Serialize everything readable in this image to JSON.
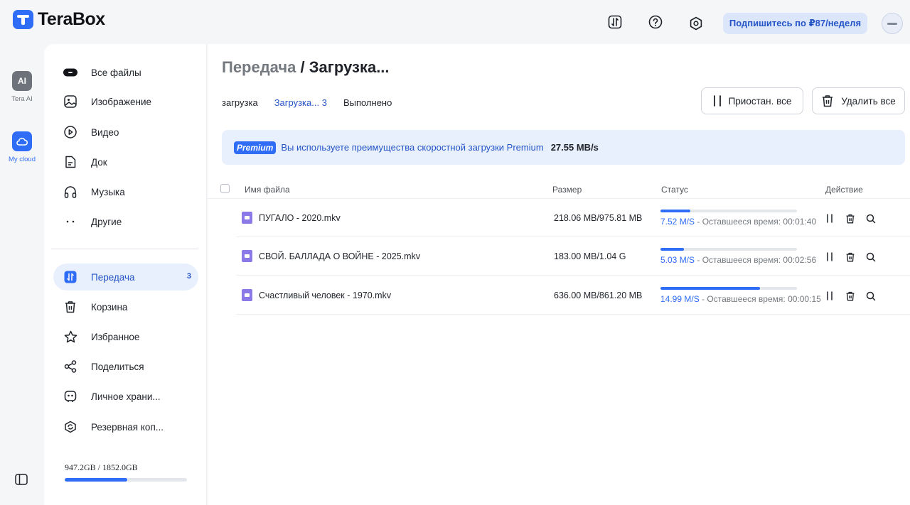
{
  "app": {
    "name": "TeraBox"
  },
  "header": {
    "subscribe_label": "Подпишитесь по ₽87/неделя",
    "icons": [
      "transfer-icon",
      "help-icon",
      "settings-icon"
    ]
  },
  "rail": {
    "items": [
      {
        "label": "Tera AI",
        "icon_text": "AI"
      },
      {
        "label": "My cloud"
      }
    ]
  },
  "sidebar": {
    "items": [
      {
        "label": "Все файлы"
      },
      {
        "label": "Изображение"
      },
      {
        "label": "Видео"
      },
      {
        "label": "Док"
      },
      {
        "label": "Музыка"
      },
      {
        "label": "Другие"
      },
      {
        "label": "Передача",
        "badge": "3"
      },
      {
        "label": "Корзина"
      },
      {
        "label": "Избранное"
      },
      {
        "label": "Поделиться"
      },
      {
        "label": "Личное храни..."
      },
      {
        "label": "Резервная коп..."
      }
    ],
    "storage": {
      "used": "947.2GB",
      "total": "1852.0GB",
      "fraction": 0.511
    }
  },
  "main": {
    "title_crumb": "Передача",
    "title_sep": " / ",
    "title_current": "Загрузка...",
    "tabs": [
      {
        "label": "загрузка"
      },
      {
        "label": "Загрузка... 3",
        "active": true
      },
      {
        "label": "Выполнено"
      }
    ],
    "pause_all_label": "Приостан. все",
    "delete_all_label": "Удалить все",
    "banner": {
      "badge": "Premium",
      "text": "Вы используете преимущества скоростной загрузки Premium",
      "speed": "27.55 MB/s"
    },
    "columns": {
      "name": "Имя файла",
      "size": "Размер",
      "status": "Статус",
      "action": "Действие"
    },
    "remaining_label": "Оставшееся время:",
    "rows": [
      {
        "name": "ПУГАЛО - 2020.mkv",
        "size": "218.06 MB/975.81 MB",
        "progress": 0.22,
        "speed": "7.52 M/S",
        "remaining": "00:01:40"
      },
      {
        "name": "СВОЙ. БАЛЛАДА О ВОЙНЕ - 2025.mkv",
        "size": "183.00 MB/1.04 G",
        "progress": 0.17,
        "speed": "5.03 M/S",
        "remaining": "00:02:56"
      },
      {
        "name": "Счастливый человек - 1970.mkv",
        "size": "636.00 MB/861.20 MB",
        "progress": 0.73,
        "speed": "14.99 M/S",
        "remaining": "00:00:15"
      }
    ]
  },
  "colors": {
    "accent": "#2f6df6",
    "accent_text": "#2554c7",
    "file_icon": "#8b79e8"
  }
}
